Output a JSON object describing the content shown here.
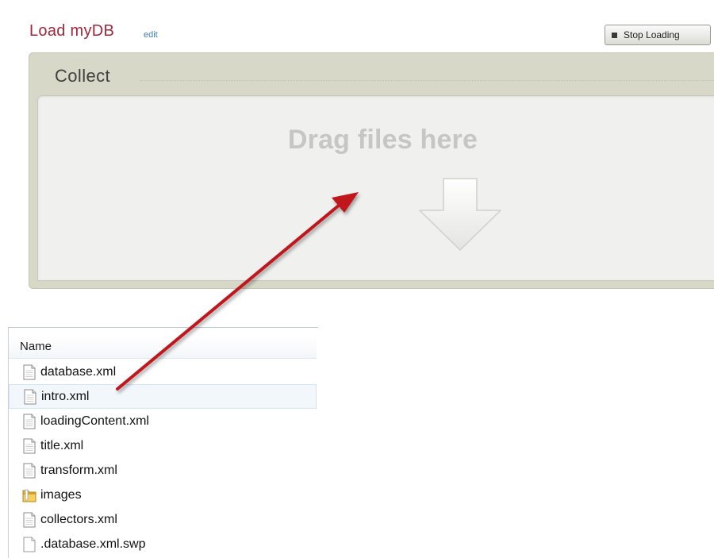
{
  "header": {
    "title": "Load myDB",
    "edit_label": "edit",
    "stop_button_label": "Stop Loading"
  },
  "collect": {
    "title": "Collect",
    "drop_text": "Drag files here"
  },
  "file_list": {
    "column_header": "Name",
    "items": [
      {
        "name": "database.xml",
        "icon": "xml-file-icon"
      },
      {
        "name": "intro.xml",
        "icon": "xml-file-icon",
        "highlighted": true
      },
      {
        "name": "loadingContent.xml",
        "icon": "xml-file-icon"
      },
      {
        "name": "title.xml",
        "icon": "xml-file-icon"
      },
      {
        "name": "transform.xml",
        "icon": "xml-file-icon"
      },
      {
        "name": "images",
        "icon": "folder-icon"
      },
      {
        "name": "collectors.xml",
        "icon": "xml-file-icon"
      },
      {
        "name": ".database.xml.swp",
        "icon": "blank-file-icon"
      }
    ]
  },
  "colors": {
    "title_red": "#a0283a",
    "link_blue": "#3a7fc0",
    "panel_bg": "#d8d8c8",
    "drop_zone_bg": "#f0f0ee",
    "annotation_arrow": "#c0141c"
  }
}
